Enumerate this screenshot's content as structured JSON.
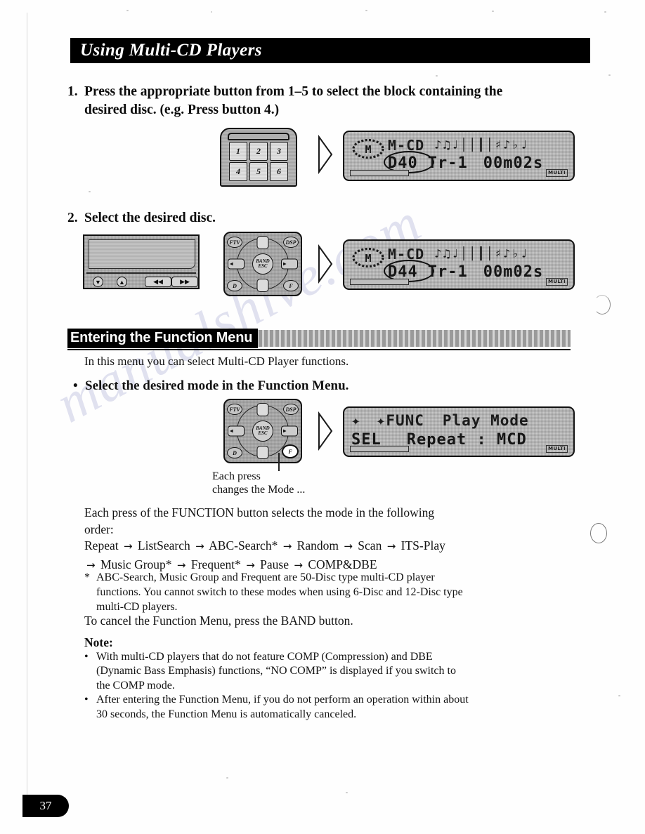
{
  "chapter": {
    "title": "Using Multi-CD Players"
  },
  "steps": [
    {
      "number": "1.",
      "text": "Press the appropriate button from 1–5 to select the block containing the desired disc. (e.g. Press button 4.)"
    },
    {
      "number": "2.",
      "text": "Select the desired disc."
    }
  ],
  "section": {
    "heading": "Entering the Function Menu",
    "intro": "In this menu you can select Multi-CD Player functions.",
    "bullet_marker": "•",
    "bullet_text": "Select the desired mode in the Function Menu."
  },
  "callout": {
    "line1": "Each press",
    "line2": "changes the Mode ..."
  },
  "body": {
    "order_intro": "Each press of the FUNCTION button selects the mode in the following order:",
    "mode_chain_line1": [
      "Repeat",
      "ListSearch",
      "ABC-Search*",
      "Random",
      "Scan",
      "ITS-Play"
    ],
    "mode_chain_line2": [
      "Music Group*",
      "Frequent*",
      "Pause",
      "COMP&DBE"
    ],
    "arrow_glyph": "→",
    "footnote_marker": "*",
    "footnote_text": "ABC-Search, Music Group and Frequent are 50-Disc type multi-CD player functions. You cannot switch to these modes when using 6-Disc and 12-Disc type multi-CD players.",
    "cancel_text": "To cancel the Function Menu, press the BAND button."
  },
  "note": {
    "heading": "Note:",
    "bullet_marker": "•",
    "items": [
      "With multi-CD players that do not feature COMP (Compression) and DBE (Dynamic Bass Emphasis) functions, “NO COMP” is displayed if you switch to the COMP mode.",
      "After entering the Function Menu, if you do not perform an operation within about 30 seconds, the Function Menu is automatically canceled."
    ]
  },
  "lcd_displays": [
    {
      "id": "lcd-step1",
      "source_label": "M-CD",
      "disc": "D40",
      "track": "Tr-1",
      "time": "00m02s",
      "eq_glyphs": "♪♫♩││┃│♯♪♭♩",
      "multi_label": "MULTI",
      "disc_circled": true
    },
    {
      "id": "lcd-step2",
      "source_label": "M-CD",
      "disc": "D44",
      "track": "Tr-1",
      "time": "00m02s",
      "eq_glyphs": "♪♫♩││┃│♯♪♭♩",
      "multi_label": "MULTI",
      "disc_circled": true
    }
  ],
  "lcd_function": {
    "id": "lcd-function",
    "left_arrows": "✦",
    "func_label": "FUNC",
    "mode_label": "Play Mode",
    "sel_label": "SEL",
    "value_label": "Repeat : MCD",
    "multi_label": "MULTI"
  },
  "keypad": {
    "keys": [
      "1",
      "2",
      "3",
      "4",
      "5",
      "6"
    ]
  },
  "headunit": {
    "button_down": "▼",
    "button_up": "▲",
    "skip_prev": "◀◀",
    "skip_next": "▶▶"
  },
  "remote": {
    "btn_top_left": "FTV",
    "btn_top_right": "DSP",
    "btn_bottom_left": "D",
    "btn_bottom_right": "F",
    "btn_center_line1": "BAND",
    "btn_center_line2": "ESC",
    "pad_left_glyph": "◀",
    "pad_right_glyph": "▶"
  },
  "footer": {
    "page_number": "37"
  },
  "watermark": {
    "text": "manualshive.com"
  },
  "colors": {
    "ink": "#111111",
    "paper": "#fefefe",
    "bar": "#000000",
    "lcd_bg": "#c9c9c9",
    "watermark": "#c9cbe4"
  }
}
